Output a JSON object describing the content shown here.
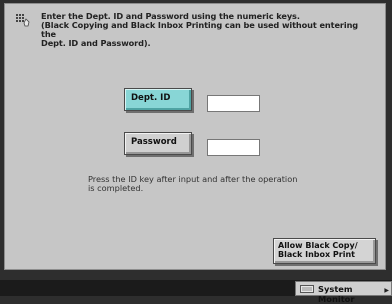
{
  "instructions": "Enter the Dept. ID and Password using the numeric keys.\n(Black Copying and Black Inbox Printing can be used without entering the\nDept. ID and Password).",
  "dept_id": {
    "label": "Dept. ID",
    "value": ""
  },
  "password": {
    "label": "Password",
    "value": ""
  },
  "note": "Press the ID key after input and after the operation\nis completed.",
  "allow_button": {
    "label": "Allow Black Copy/\nBlack Inbox Print"
  },
  "status_bar": {
    "system_monitor_label": "System Monitor",
    "arrow_icon": "arrow-right-icon"
  },
  "colors": {
    "panel": "#c6c6c6",
    "selected_key": "#88d6d6",
    "background": "#2e2e2e"
  },
  "icons": {
    "instruction": "keypad-icon",
    "monitor": "monitor-icon"
  }
}
